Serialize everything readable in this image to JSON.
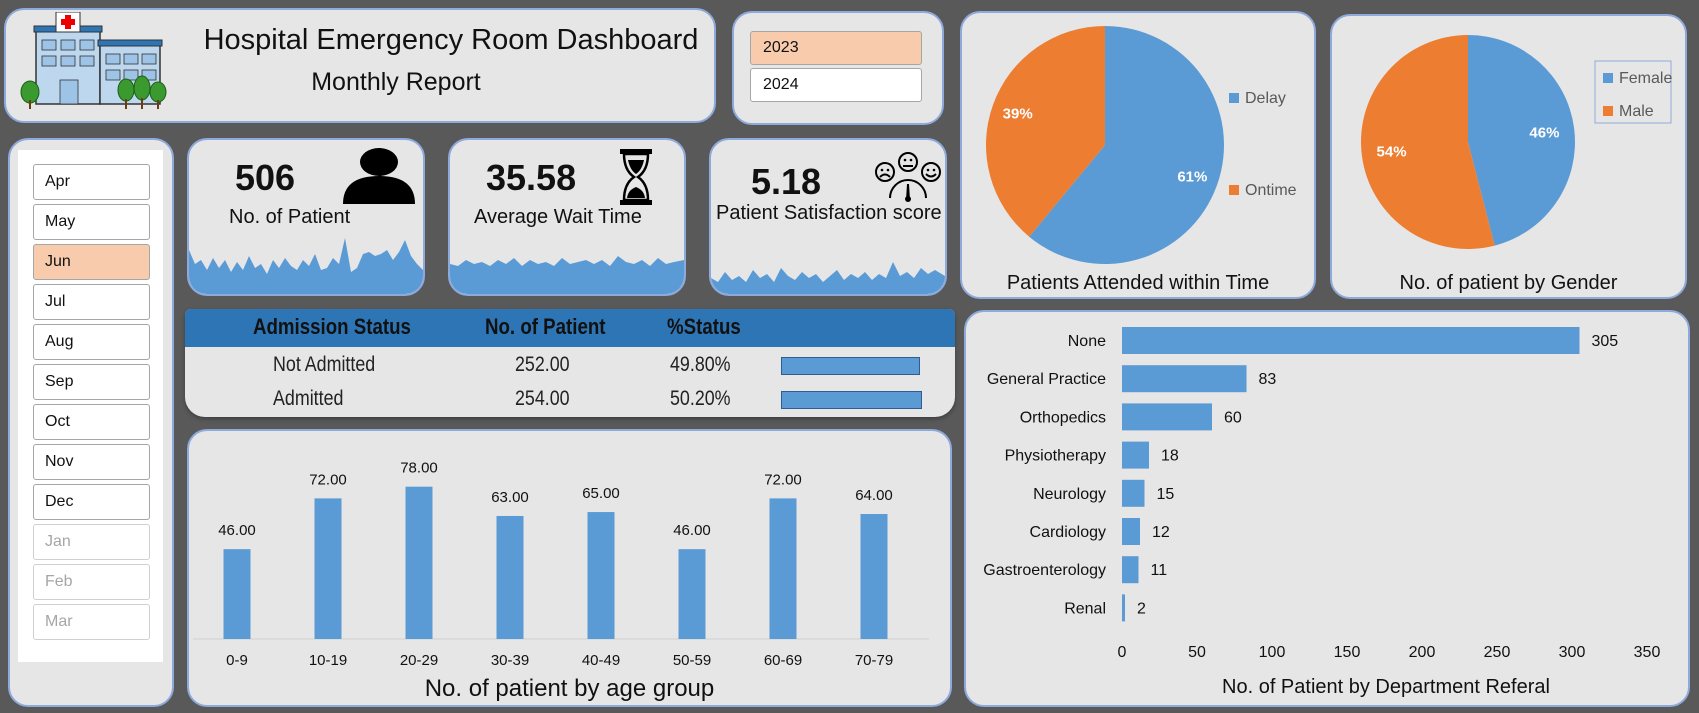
{
  "header": {
    "title": "Hospital Emergency Room Dashboard",
    "subtitle": "Monthly Report"
  },
  "years": [
    {
      "label": "2023",
      "selected": true
    },
    {
      "label": "2024",
      "selected": false
    }
  ],
  "months": [
    {
      "label": "Apr",
      "state": "normal"
    },
    {
      "label": "May",
      "state": "normal"
    },
    {
      "label": "Jun",
      "state": "selected"
    },
    {
      "label": "Jul",
      "state": "normal"
    },
    {
      "label": "Aug",
      "state": "normal"
    },
    {
      "label": "Sep",
      "state": "normal"
    },
    {
      "label": "Oct",
      "state": "normal"
    },
    {
      "label": "Nov",
      "state": "normal"
    },
    {
      "label": "Dec",
      "state": "normal"
    },
    {
      "label": "Jan",
      "state": "dim"
    },
    {
      "label": "Feb",
      "state": "dim"
    },
    {
      "label": "Mar",
      "state": "dim"
    }
  ],
  "kpis": {
    "patients": {
      "value": "506",
      "label": "No. of Patient",
      "icon": "person-icon"
    },
    "wait": {
      "value": "35.58",
      "label": "Average Wait Time",
      "icon": "hourglass-icon"
    },
    "satisfaction": {
      "value": "5.18",
      "label": "Patient Satisfaction score",
      "icon": "satisfaction-meter-icon"
    }
  },
  "admission": {
    "headers": [
      "Admission Status",
      "No. of  Patient",
      "%Status"
    ],
    "rows": [
      {
        "status": "Not Admitted",
        "count": "252.00",
        "pct": "49.80%",
        "pct_value": 49.8
      },
      {
        "status": "Admitted",
        "count": "254.00",
        "pct": "50.20%",
        "pct_value": 50.2
      }
    ]
  },
  "colors": {
    "blue": "#5b9bd5",
    "orange": "#ed7d31",
    "selected": "#f8cbad",
    "header_blue": "#2e75b6"
  },
  "chart_data": [
    {
      "type": "pie",
      "title": "Patients Attended within Time",
      "labels": [
        "Delay",
        "Ontime"
      ],
      "values": [
        61,
        39
      ],
      "value_labels": [
        "61%",
        "39%"
      ],
      "legend": "right"
    },
    {
      "type": "pie",
      "title": "No. of patient by Gender",
      "labels": [
        "Female",
        "Male"
      ],
      "values": [
        46,
        54
      ],
      "value_labels": [
        "46%",
        "54%"
      ],
      "legend": "top-right"
    },
    {
      "type": "bar",
      "title": "No. of patient by age group",
      "categories": [
        "0-9",
        "10-19",
        "20-29",
        "30-39",
        "40-49",
        "50-59",
        "60-69",
        "70-79"
      ],
      "values": [
        46,
        72,
        78,
        63,
        65,
        46,
        72,
        64
      ],
      "value_labels": [
        "46.00",
        "72.00",
        "78.00",
        "63.00",
        "65.00",
        "46.00",
        "72.00",
        "64.00"
      ],
      "ylim": [
        0,
        85
      ]
    },
    {
      "type": "bar",
      "orientation": "horizontal",
      "title": "No. of Patient by Department Referal",
      "categories": [
        "None",
        "General Practice",
        "Orthopedics",
        "Physiotherapy",
        "Neurology",
        "Cardiology",
        "Gastroenterology",
        "Renal"
      ],
      "values": [
        305,
        83,
        60,
        18,
        15,
        12,
        11,
        2
      ],
      "xlim": [
        0,
        350
      ],
      "xticks": [
        "0",
        "50",
        "100",
        "150",
        "200",
        "250",
        "300",
        "350"
      ]
    }
  ]
}
